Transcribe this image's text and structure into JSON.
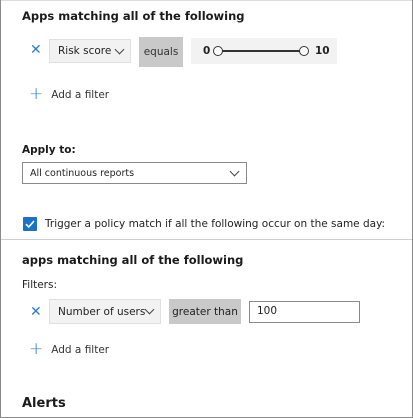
{
  "section1": {
    "heading": "Apps matching all of the following",
    "filter": {
      "remove_icon": "close-icon",
      "field_value": "Risk score",
      "operator": "equals",
      "range_min": "0",
      "range_max": "10"
    },
    "add_filter_label": "Add a filter"
  },
  "apply_to": {
    "label": "Apply to:",
    "selected_value": "All continuous reports"
  },
  "trigger": {
    "checked": true,
    "label": "Trigger a policy match if all the following occur on the same day:"
  },
  "section2": {
    "heading": "apps matching all of the following",
    "filters_label": "Filters:",
    "filter": {
      "remove_icon": "close-icon",
      "field_value": "Number of users",
      "operator": "greater than",
      "value": "100"
    },
    "add_filter_label": "Add a filter"
  },
  "alerts": {
    "heading": "Alerts"
  },
  "colors": {
    "accent": "#1a73c9",
    "link_icon": "#2b7bd6",
    "operator_bg": "#c9c9c9"
  }
}
